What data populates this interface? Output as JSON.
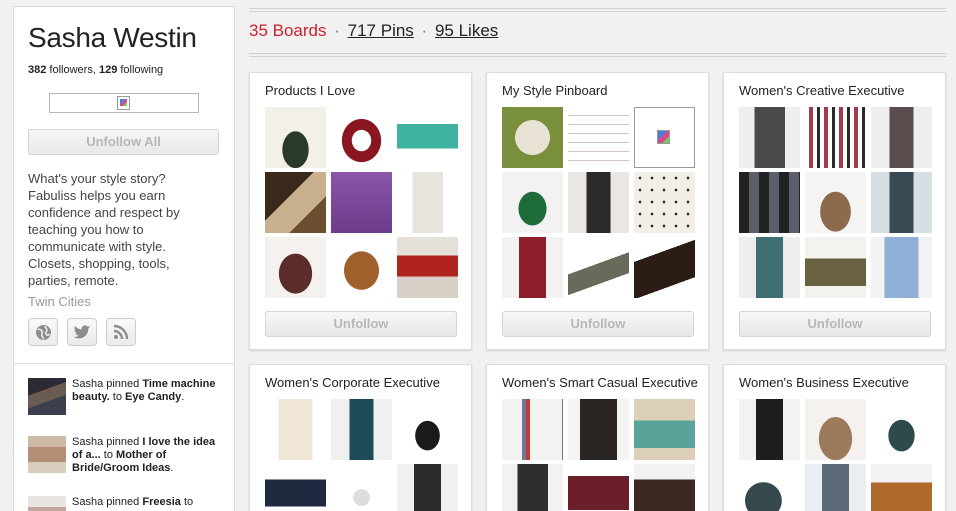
{
  "profile": {
    "name": "Sasha Westin",
    "followers_count": "382",
    "followers_label": "followers,",
    "following_count": "129",
    "following_label": "following",
    "unfollow_all_label": "Unfollow All",
    "bio": "What's your style story? Fabuliss helps you earn confidence and respect by teaching you how to communicate with style. Closets, shopping, tools, parties, remote.",
    "location": "Twin Cities",
    "social_icons": [
      "globe-icon",
      "twitter-icon",
      "rss-icon"
    ]
  },
  "activity": [
    {
      "prefix": "Sasha pinned",
      "pin": "Time machine beauty.",
      "mid": "to",
      "board": "Eye Candy",
      "end": "."
    },
    {
      "prefix": "Sasha pinned",
      "pin": "I love the idea of a...",
      "mid": "to",
      "board": "Mother of Bride/Groom Ideas",
      "end": "."
    },
    {
      "prefix": "Sasha pinned",
      "pin": "Freesia",
      "mid": "to",
      "board": "",
      "end": ""
    }
  ],
  "stats": {
    "boards": "35 Boards",
    "sep1": "·",
    "pins": "717 Pins",
    "sep2": "·",
    "likes": "95 Likes"
  },
  "boards": [
    {
      "title": "Products I Love",
      "button": "Unfollow"
    },
    {
      "title": "My Style Pinboard",
      "button": "Unfollow"
    },
    {
      "title": "Women's Creative Executive",
      "button": "Unfollow"
    },
    {
      "title": "Women's Corporate Executive",
      "button": ""
    },
    {
      "title": "Women's Smart Casual Executive",
      "button": ""
    },
    {
      "title": "Women's Business Executive",
      "button": ""
    }
  ],
  "colors": {
    "accent_red": "#c8232c",
    "background": "#f2f0f0",
    "button_text": "#b9b6b6"
  }
}
